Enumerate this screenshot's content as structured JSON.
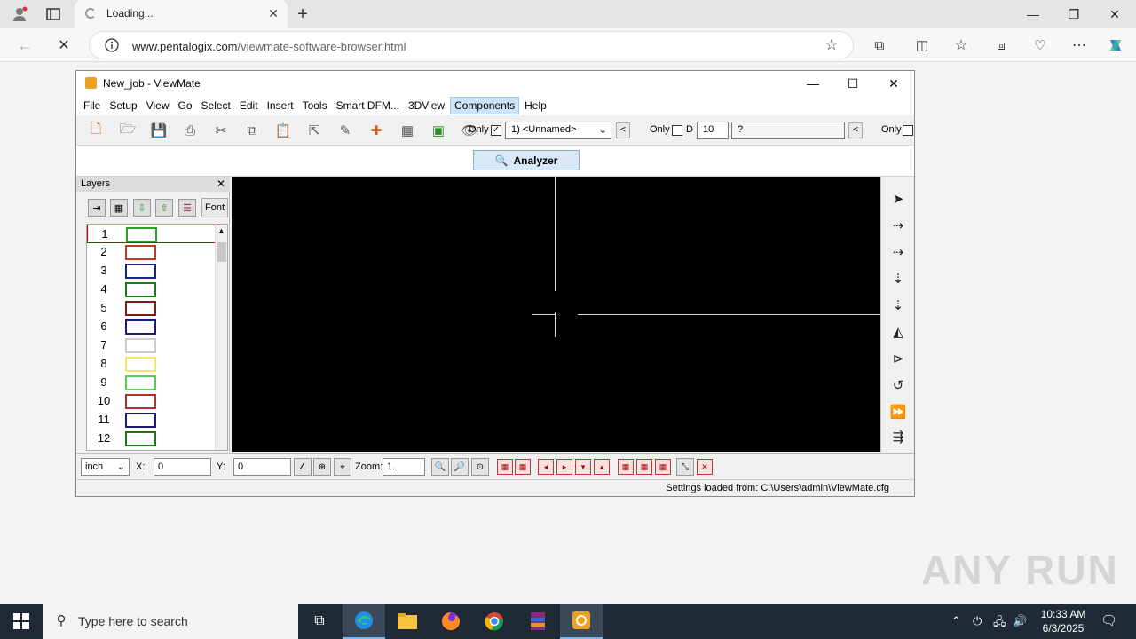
{
  "browser": {
    "tab_title": "Loading...",
    "url_host": "www.pentalogix.com",
    "url_path": "/viewmate-software-browser.html"
  },
  "viewmate": {
    "window_title": "New_job - ViewMate",
    "menu": [
      "File",
      "Setup",
      "View",
      "Go",
      "Select",
      "Edit",
      "Insert",
      "Tools",
      "Smart DFM...",
      "3DView",
      "Components",
      "Help"
    ],
    "active_menu": "Components",
    "only_label_1": "Only",
    "only_label_2": "Only",
    "only_label_3": "Only",
    "d_label": "D",
    "d_value": "10",
    "unnamed_combo": "1) <Unnamed>",
    "query_value": "?",
    "analyzer_label": "Analyzer",
    "layers_title": "Layers",
    "font_label": "Font",
    "layers": [
      {
        "num": "1",
        "color": "#2ca02c"
      },
      {
        "num": "2",
        "color": "#c0392b"
      },
      {
        "num": "3",
        "color": "#1a237e"
      },
      {
        "num": "4",
        "color": "#1b7a1b"
      },
      {
        "num": "5",
        "color": "#7b1c1c"
      },
      {
        "num": "6",
        "color": "#1a1a7a"
      },
      {
        "num": "7",
        "color": "#cccccc"
      },
      {
        "num": "8",
        "color": "#f5e663"
      },
      {
        "num": "9",
        "color": "#4cd44c"
      },
      {
        "num": "10",
        "color": "#b03030"
      },
      {
        "num": "11",
        "color": "#1a1a80"
      },
      {
        "num": "12",
        "color": "#1b7a1b"
      }
    ],
    "unit_select": "inch",
    "x_label": "X:",
    "x_value": "0",
    "y_label": "Y:",
    "y_value": "0",
    "zoom_label": "Zoom:",
    "zoom_value": "1.",
    "status_text": "Settings loaded from: C:\\Users\\admin\\ViewMate.cfg"
  },
  "watermark": "ANY RUN",
  "taskbar": {
    "search_placeholder": "Type here to search",
    "time": "10:33 AM",
    "date": "6/3/2025"
  }
}
